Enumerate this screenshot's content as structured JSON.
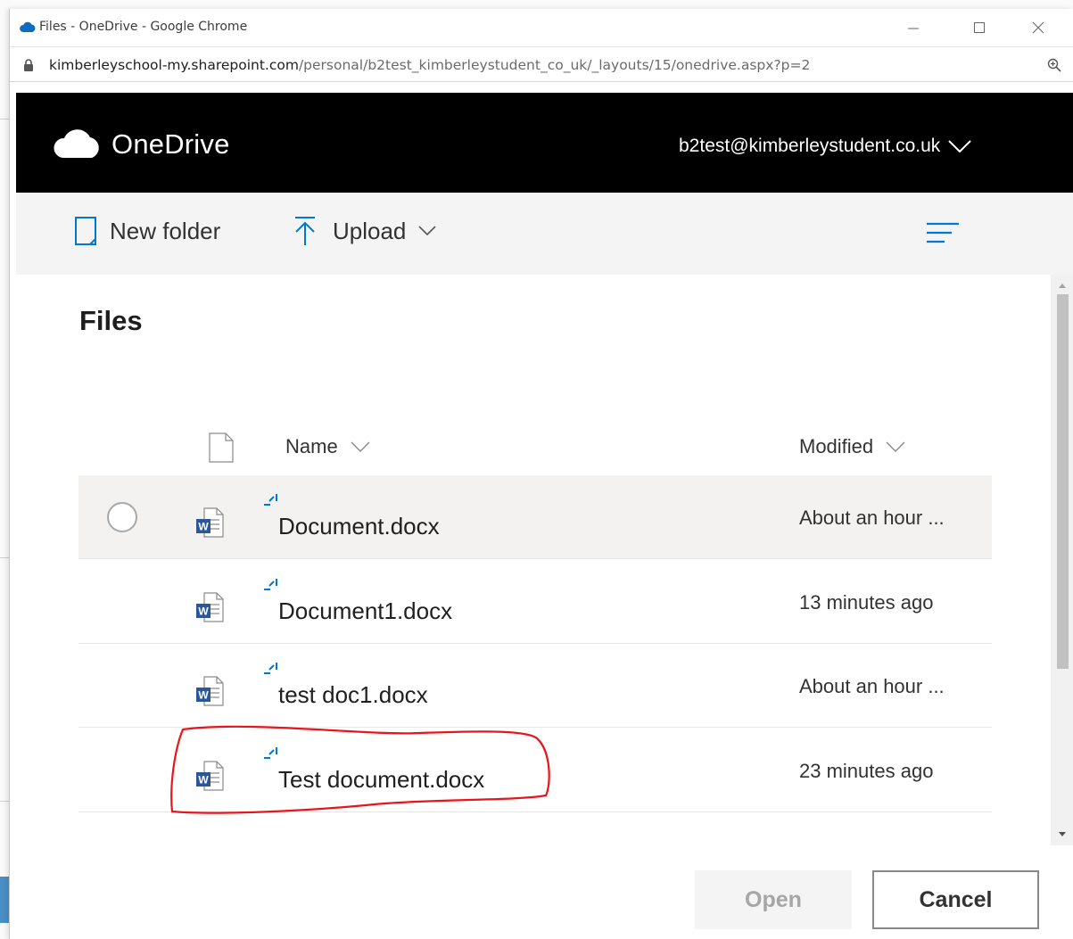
{
  "browser": {
    "window_title": "Files - OneDrive - Google Chrome",
    "url_host": "kimberleyschool-my.sharepoint.com",
    "url_path": "/personal/b2test_kimberleystudent_co_uk/_layouts/15/onedrive.aspx?p=2"
  },
  "header": {
    "brand": "OneDrive",
    "account": "b2test@kimberleystudent.co.uk"
  },
  "commands": {
    "new_folder": "New folder",
    "upload": "Upload"
  },
  "content": {
    "heading": "Files",
    "columns": {
      "name": "Name",
      "modified": "Modified"
    },
    "files": [
      {
        "name": "Document.docx",
        "modified": "About an hour ...",
        "selected": true
      },
      {
        "name": "Document1.docx",
        "modified": "13 minutes ago",
        "selected": false
      },
      {
        "name": "test doc1.docx",
        "modified": "About an hour ...",
        "selected": false
      },
      {
        "name": "Test document.docx",
        "modified": "23 minutes ago",
        "selected": false
      }
    ]
  },
  "buttons": {
    "open": "Open",
    "cancel": "Cancel"
  },
  "colors": {
    "accent": "#0078d4",
    "word_blue": "#2b579a",
    "header_bg": "#000000",
    "annotation": "#e8161b"
  }
}
